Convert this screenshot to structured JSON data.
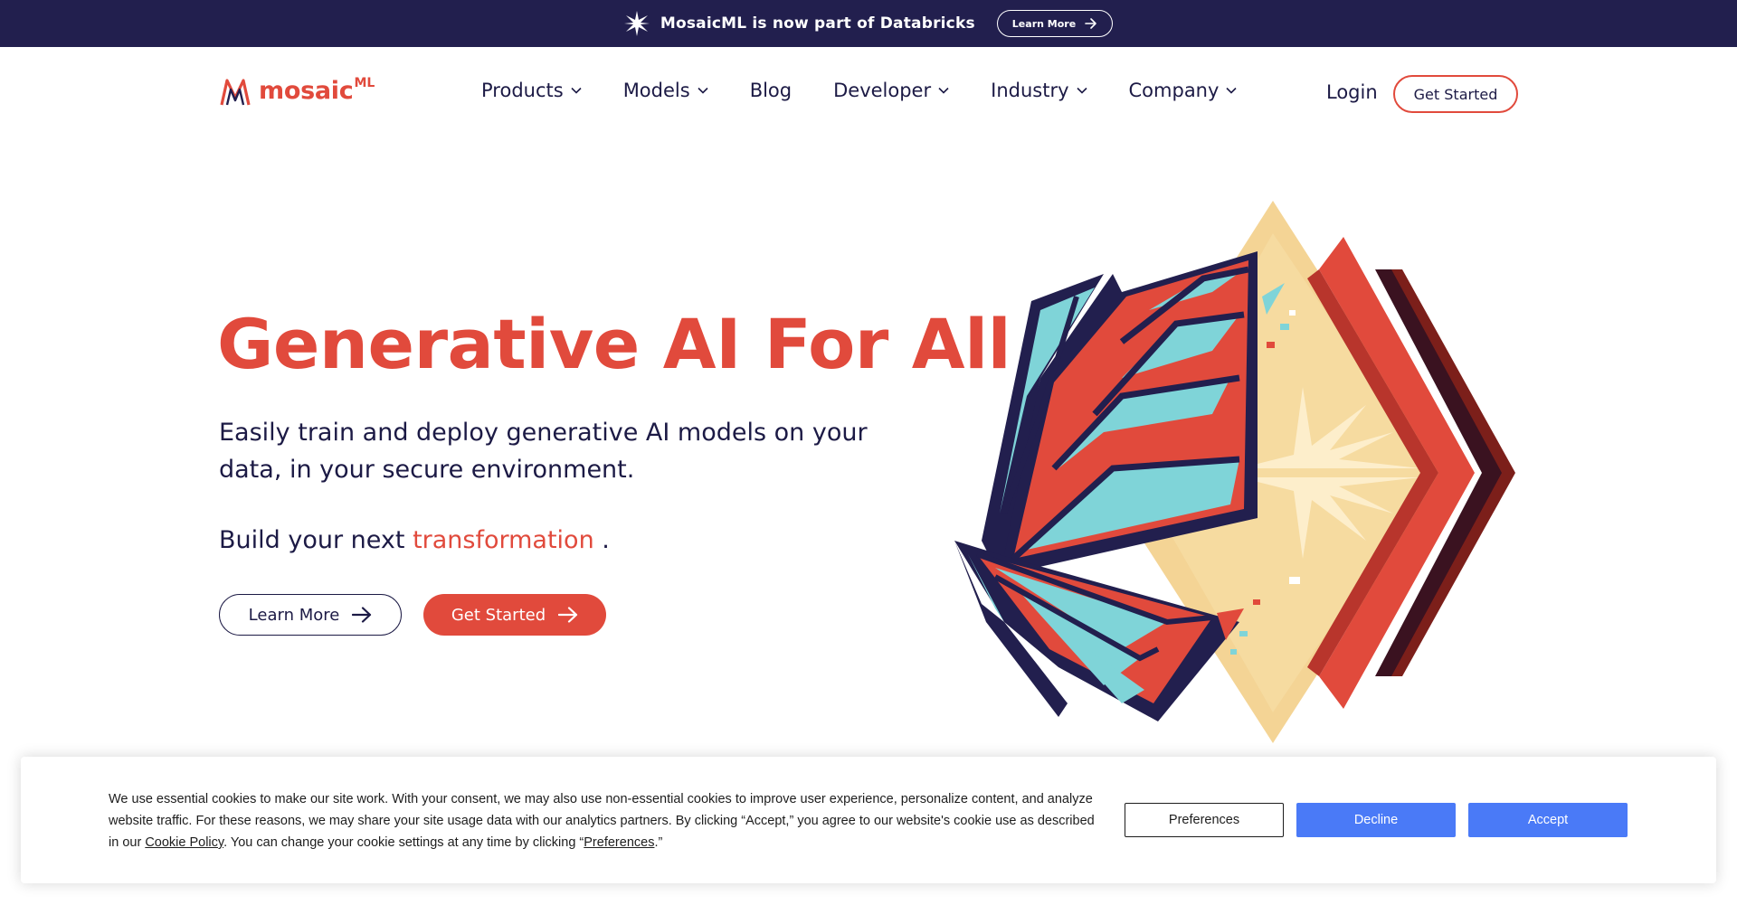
{
  "announcement": {
    "text": "MosaicML is now part of Databricks",
    "button_label": "Learn More"
  },
  "header": {
    "logo_text": "mosaic",
    "logo_sup": "ML",
    "nav": [
      {
        "label": "Products",
        "has_dropdown": true
      },
      {
        "label": "Models",
        "has_dropdown": true
      },
      {
        "label": "Blog",
        "has_dropdown": false
      },
      {
        "label": "Developer",
        "has_dropdown": true
      },
      {
        "label": "Industry",
        "has_dropdown": true
      },
      {
        "label": "Company",
        "has_dropdown": true
      }
    ],
    "login_label": "Login",
    "get_started_label": "Get Started"
  },
  "hero": {
    "title": "Generative AI For All",
    "subtitle": "Easily train and deploy generative AI models on your data, in your secure environment.",
    "build_prefix": "Build your next",
    "build_accent": "transformation",
    "build_suffix": ".",
    "learn_more_label": "Learn More",
    "get_started_label": "Get Started"
  },
  "cookie": {
    "text_part1": "We use essential cookies to make our site work. With your consent, we may also use non-essential cookies to improve user experience, personalize content, and analyze website traffic. For these reasons, we may share your site usage data with our analytics partners. By clicking “Accept,” you agree to our website's cookie use as described in our ",
    "cookie_policy_link": "Cookie Policy",
    "text_part2": ". You can change your cookie settings at any time by clicking “",
    "preferences_link": "Preferences",
    "text_part3": ".”",
    "preferences_button": "Preferences",
    "decline_button": "Decline",
    "accept_button": "Accept"
  },
  "colors": {
    "brand_red": "#e14a3c",
    "navy": "#221f4e",
    "cookie_blue": "#4a7af7"
  }
}
